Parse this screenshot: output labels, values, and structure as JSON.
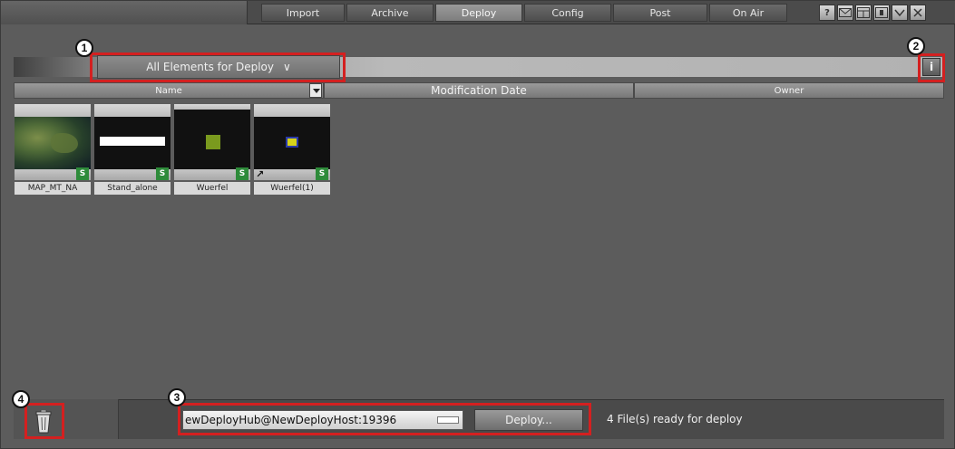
{
  "nav": {
    "tabs": [
      "Import",
      "Archive",
      "Deploy",
      "Config",
      "Post",
      "On Air"
    ],
    "active_tab": "Deploy",
    "icons": [
      "help-icon",
      "mail-icon",
      "layout-icon",
      "info-panel-icon",
      "dropdown-icon",
      "close-icon"
    ]
  },
  "filter": {
    "selected": "All Elements for Deploy",
    "chevron": "∨"
  },
  "info_button": "i",
  "columns": [
    "Name",
    "Modification Date",
    "Owner"
  ],
  "items": [
    {
      "caption": "MAP_MT_NA",
      "badge": "S",
      "thumb": "map"
    },
    {
      "caption": "Stand_alone",
      "badge": "S",
      "thumb": "white-bar"
    },
    {
      "caption": "Wuerfel",
      "badge": "S",
      "thumb": "green-square"
    },
    {
      "caption": "Wuerfel(1)",
      "badge": "S",
      "thumb": "yellow-square",
      "linked": true
    }
  ],
  "deploy": {
    "hub_value": "ewDeployHub@NewDeployHost:19396",
    "button_label": "Deploy...",
    "status": "4 File(s) ready for deploy"
  },
  "callouts": [
    "1",
    "2",
    "3",
    "4"
  ],
  "colors": {
    "callout": "#d42020",
    "badge": "#2e8b3a",
    "background": "#5c5c5c"
  }
}
